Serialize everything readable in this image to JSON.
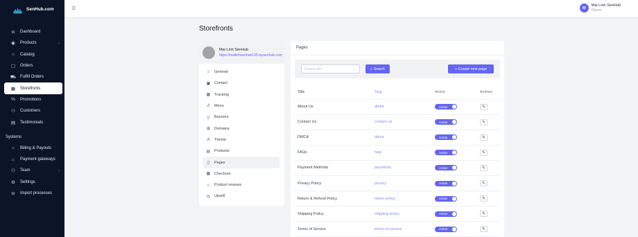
{
  "brand": {
    "name": "SenHub.com"
  },
  "topbar": {
    "menu_icon": "menu-icon",
    "user": {
      "initial": "M",
      "name": "Mai Linh SenHub",
      "role": "Owner"
    }
  },
  "sidebar": {
    "items": [
      {
        "label": "Dashboard",
        "icon": "chart-icon",
        "glyph": "ılı"
      },
      {
        "label": "Products",
        "icon": "cube-icon",
        "glyph": "◉",
        "chevron": "⌄"
      },
      {
        "label": "Catalog",
        "icon": "catalog-icon",
        "glyph": "⌂"
      },
      {
        "label": "Orders",
        "icon": "orders-icon",
        "glyph": "▢"
      },
      {
        "label": "Fulfill Orders",
        "icon": "truck-icon",
        "glyph": "⛟"
      },
      {
        "label": "Storefronts",
        "icon": "store-icon",
        "glyph": "▦",
        "active": true
      },
      {
        "label": "Promotions",
        "icon": "percent-icon",
        "glyph": "%"
      },
      {
        "label": "Customers",
        "icon": "users-icon",
        "glyph": "⚇"
      },
      {
        "label": "Testimonials",
        "icon": "chat-icon",
        "glyph": "▤"
      }
    ],
    "section": "Systems",
    "system_items": [
      {
        "label": "Billing & Payouts",
        "icon": "bank-icon",
        "glyph": "⌂"
      },
      {
        "label": "Payment gateways",
        "icon": "bank-icon",
        "glyph": "⌂"
      },
      {
        "label": "Team",
        "icon": "team-icon",
        "glyph": "⚇",
        "chevron": "⌄"
      },
      {
        "label": "Settings",
        "icon": "settings-icon",
        "glyph": "⚙"
      },
      {
        "label": "Import processes",
        "icon": "import-icon",
        "glyph": "⊖"
      }
    ]
  },
  "main": {
    "title": "Storefronts",
    "store": {
      "name": "Mai Linh SenHub",
      "url": "https://mailinhsenhub135.mysenhub.com"
    },
    "menu": [
      {
        "label": "General",
        "glyph": "⌂"
      },
      {
        "label": "Contact",
        "glyph": "▣"
      },
      {
        "label": "Tracking",
        "glyph": "▦"
      },
      {
        "label": "Menu",
        "glyph": "∂"
      },
      {
        "label": "Banners",
        "glyph": "▯"
      },
      {
        "label": "Domains",
        "glyph": "◍"
      },
      {
        "label": "Theme",
        "glyph": "A"
      },
      {
        "label": "Products",
        "glyph": "▤"
      },
      {
        "label": "Pages",
        "glyph": "▯",
        "active": true
      },
      {
        "label": "Checkout",
        "glyph": "▦"
      },
      {
        "label": "Product reviews",
        "glyph": "☆"
      },
      {
        "label": "Upsell",
        "glyph": "◎"
      }
    ],
    "pages": {
      "title": "Pages",
      "search_placeholder": "Search title",
      "search_label": "Search",
      "create_label": "+ Create new page",
      "columns": {
        "title": "Title",
        "slug": "Slug",
        "active": "Active",
        "actions": "Actions"
      },
      "rows": [
        {
          "title": "About Us",
          "slug": "about",
          "active": "Active"
        },
        {
          "title": "Contact Us",
          "slug": "contact-us",
          "active": "Active"
        },
        {
          "title": "DMCA",
          "slug": "dmca",
          "active": "Active"
        },
        {
          "title": "FAQs",
          "slug": "faqs",
          "active": "Active"
        },
        {
          "title": "Payment Methods",
          "slug": "payments",
          "active": "Active"
        },
        {
          "title": "Privacy Policy",
          "slug": "privacy",
          "active": "Active"
        },
        {
          "title": "Return & Refund Policy",
          "slug": "return-policy",
          "active": "Active"
        },
        {
          "title": "Shipping Policy",
          "slug": "shipping-policy",
          "active": "Active"
        },
        {
          "title": "Terms of Service",
          "slug": "terms-of-service",
          "active": "Active"
        }
      ]
    }
  },
  "colors": {
    "sidebar_bg": "#0b1527",
    "accent": "#6366f1",
    "page_bg": "#f3f4f6"
  }
}
